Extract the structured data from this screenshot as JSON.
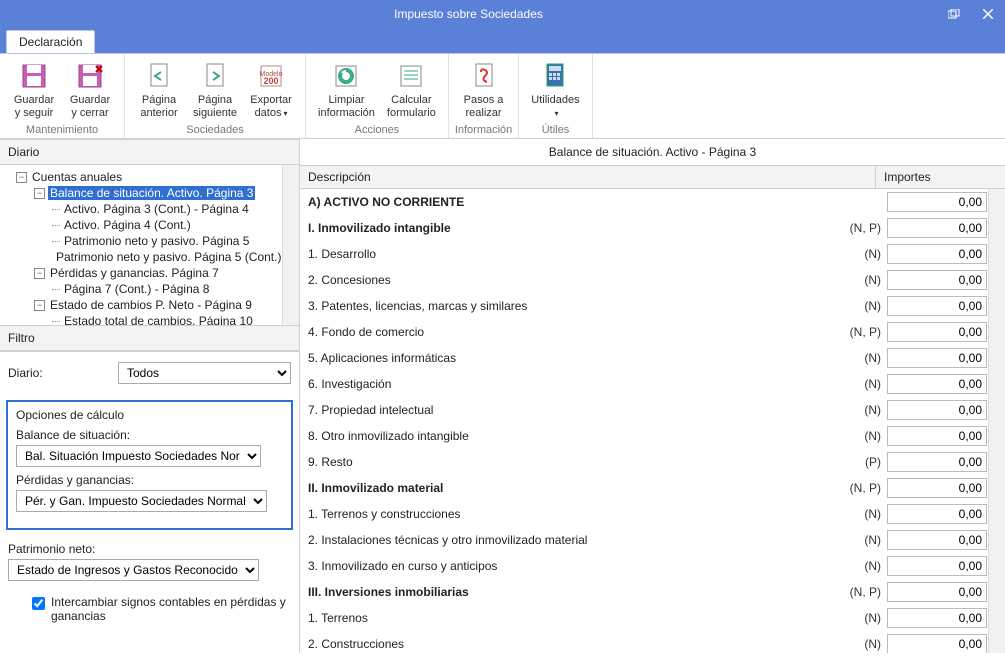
{
  "window": {
    "title": "Impuesto sobre Sociedades"
  },
  "tab": {
    "label": "Declaración"
  },
  "ribbon": {
    "groups": [
      {
        "name": "Mantenimiento",
        "items": [
          {
            "label": "Guardar\ny seguir"
          },
          {
            "label": "Guardar\ny cerrar"
          }
        ]
      },
      {
        "name": "Sociedades",
        "items": [
          {
            "label": "Página\nanterior"
          },
          {
            "label": "Página\nsiguiente"
          },
          {
            "label": "Exportar\ndatos",
            "drop": true
          }
        ]
      },
      {
        "name": "Acciones",
        "items": [
          {
            "label": "Limpiar\ninformación"
          },
          {
            "label": "Calcular\nformulario"
          }
        ]
      },
      {
        "name": "Información",
        "items": [
          {
            "label": "Pasos a\nrealizar"
          }
        ]
      },
      {
        "name": "Útiles",
        "items": [
          {
            "label": "Utilidades",
            "drop": true
          }
        ]
      }
    ]
  },
  "left": {
    "diario_header": "Diario",
    "tree": {
      "root": "Cuentas anuales",
      "n1": "Balance de situación. Activo. Página 3",
      "n2": "Activo. Página 3 (Cont.) - Página 4",
      "n3": "Activo. Página 4 (Cont.)",
      "n4": "Patrimonio neto y pasivo. Página 5",
      "n5": "Patrimonio neto y pasivo. Página 5 (Cont.)",
      "n6": "Pérdidas y ganancias. Página 7",
      "n7": "Página 7 (Cont.) - Página 8",
      "n8": "Estado de cambios P. Neto - Página 9",
      "n9": "Estado total de cambios. Página 10"
    },
    "filtro_header": "Filtro",
    "diario_label": "Diario:",
    "diario_value": "Todos",
    "calc": {
      "title": "Opciones de cálculo",
      "bal_label": "Balance de situación:",
      "bal_value": "Bal. Situación  Impuesto Sociedades Nor",
      "pyg_label": "Pérdidas y ganancias:",
      "pyg_value": "Pér. y Gan. Impuesto Sociedades Normal"
    },
    "patr_label": "Patrimonio neto:",
    "patr_value": "Estado de Ingresos y Gastos Reconocido",
    "check_label": "Intercambiar signos contables en pérdidas y ganancias"
  },
  "right": {
    "title": "Balance de situación. Activo - Página 3",
    "col_desc": "Descripción",
    "col_imp": "Importes",
    "rows": [
      {
        "d": "A) ACTIVO NO CORRIENTE",
        "t": "",
        "v": "0,00",
        "b": true
      },
      {
        "d": "I. Inmovilizado intangible",
        "t": "(N, P)",
        "v": "0,00",
        "b": true
      },
      {
        "d": "1. Desarrollo",
        "t": "(N)",
        "v": "0,00"
      },
      {
        "d": "2. Concesiones",
        "t": "(N)",
        "v": "0,00"
      },
      {
        "d": "3. Patentes, licencias, marcas y similares",
        "t": "(N)",
        "v": "0,00"
      },
      {
        "d": "4. Fondo de comercio",
        "t": "(N, P)",
        "v": "0,00"
      },
      {
        "d": "5. Aplicaciones informáticas",
        "t": "(N)",
        "v": "0,00"
      },
      {
        "d": "6. Investigación",
        "t": "(N)",
        "v": "0,00"
      },
      {
        "d": "7. Propiedad intelectual",
        "t": "(N)",
        "v": "0,00"
      },
      {
        "d": "8. Otro inmovilizado intangible",
        "t": "(N)",
        "v": "0,00"
      },
      {
        "d": "9. Resto",
        "t": "(P)",
        "v": "0,00"
      },
      {
        "d": "II. Inmovilizado material",
        "t": "(N, P)",
        "v": "0,00",
        "b": true
      },
      {
        "d": "1. Terrenos y construcciones",
        "t": "(N)",
        "v": "0,00"
      },
      {
        "d": "2. Instalaciones técnicas y otro inmovilizado material",
        "t": "(N)",
        "v": "0,00"
      },
      {
        "d": "3. Inmovilizado en curso y anticipos",
        "t": "(N)",
        "v": "0,00"
      },
      {
        "d": "III. Inversiones inmobiliarias",
        "t": "(N, P)",
        "v": "0,00",
        "b": true
      },
      {
        "d": "1. Terrenos",
        "t": "(N)",
        "v": "0,00"
      },
      {
        "d": "2. Construcciones",
        "t": "(N)",
        "v": "0,00"
      }
    ]
  }
}
